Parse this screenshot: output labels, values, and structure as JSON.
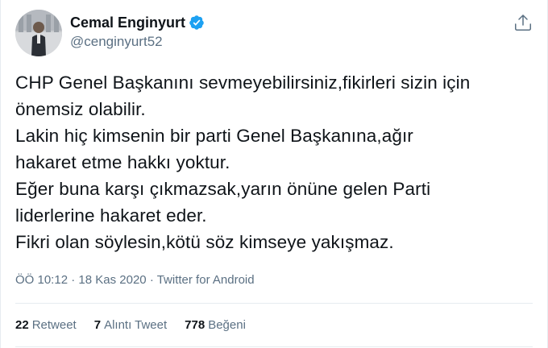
{
  "tweet": {
    "author": {
      "display_name": "Cemal Enginyurt",
      "handle": "@cenginyurt52",
      "verified": true
    },
    "text_lines": [
      "CHP Genel Başkanını sevmeyebilirsiniz,fikirleri sizin için",
      "önemsiz olabilir.",
      "Lakin hiç kimsenin bir parti Genel Başkanına,ağır",
      "hakaret etme hakkı yoktur.",
      "Eğer buna karşı çıkmazsak,yarın önüne gelen Parti",
      "liderlerine hakaret eder.",
      "Fikri olan söylesin,kötü söz kimseye yakışmaz."
    ],
    "meta": {
      "time": "ÖÖ 10:12",
      "separator": "·",
      "date": "18 Kas 2020",
      "source": "Twitter for Android"
    },
    "stats": {
      "retweets": {
        "count": "22",
        "label": "Retweet"
      },
      "quotes": {
        "count": "7",
        "label": "Alıntı Tweet"
      },
      "likes": {
        "count": "778",
        "label": "Beğeni"
      }
    }
  },
  "icons": {
    "verified": "verified-badge-icon",
    "share": "share-icon"
  },
  "colors": {
    "verified_blue": "#1da1f2",
    "secondary_text": "#5b7083",
    "primary_text": "#0f1419",
    "divider": "#e6ecf0"
  }
}
